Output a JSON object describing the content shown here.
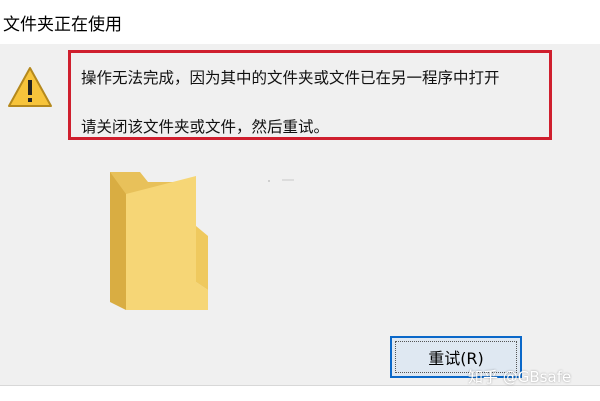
{
  "dialog": {
    "title": "文件夹正在使用",
    "message_line1": "操作无法完成，因为其中的文件夹或文件已在另一程序中打开",
    "message_line2": "请关闭该文件夹或文件，然后重试。",
    "retry_label": "重试(R)"
  },
  "icons": {
    "warning": "warning-icon",
    "folder": "folder-icon"
  },
  "watermark": "知乎 @GBsafe",
  "colors": {
    "highlight_border": "#cf1f2e",
    "button_border": "#0a68c9",
    "warning_fill": "#f7c43b",
    "folder_fill": "#f6d676"
  }
}
